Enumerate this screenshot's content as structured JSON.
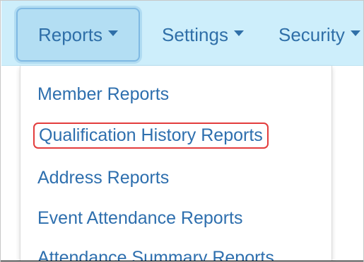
{
  "navbar": {
    "items": [
      {
        "label": "Reports",
        "active": true
      },
      {
        "label": "Settings",
        "active": false
      },
      {
        "label": "Security",
        "active": false
      }
    ]
  },
  "dropdown": {
    "items": [
      {
        "label": "Member Reports",
        "highlighted": false
      },
      {
        "label": "Qualification History Reports",
        "highlighted": true
      },
      {
        "label": "Address Reports",
        "highlighted": false
      },
      {
        "label": "Event Attendance Reports",
        "highlighted": false
      },
      {
        "label": "Attendance Summary Reports",
        "highlighted": false
      }
    ]
  },
  "colors": {
    "navbar_bg": "#cdeefb",
    "active_tab_bg": "#b3def3",
    "link": "#2e6fae",
    "highlight_border": "#e33d3d"
  }
}
